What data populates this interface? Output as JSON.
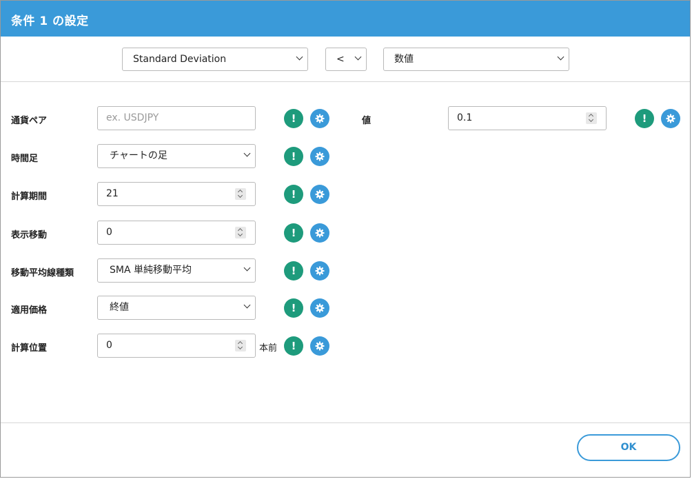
{
  "dialog": {
    "title": "条件 1 の設定"
  },
  "condition": {
    "indicator": "Standard Deviation",
    "operator": "<",
    "compare_type": "数値"
  },
  "left_fields": [
    {
      "label": "通貨ペア",
      "placeholder": "ex. USDJPY",
      "value": ""
    },
    {
      "label": "時間足",
      "value": "チャートの足"
    },
    {
      "label": "計算期間",
      "value": "21"
    },
    {
      "label": "表示移動",
      "value": "0"
    },
    {
      "label": "移動平均線種類",
      "value": "SMA 単純移動平均"
    },
    {
      "label": "適用価格",
      "value": "終値"
    },
    {
      "label": "計算位置",
      "value": "0",
      "suffix": "本前"
    }
  ],
  "right_fields": [
    {
      "label": "値",
      "value": "0.1"
    }
  ],
  "icons": {
    "info": "exclamation-icon",
    "settings": "gear-icon"
  },
  "colors": {
    "accent": "#3a9ad9",
    "info_green": "#1e9b7c"
  },
  "footer": {
    "ok_label": "OK"
  }
}
